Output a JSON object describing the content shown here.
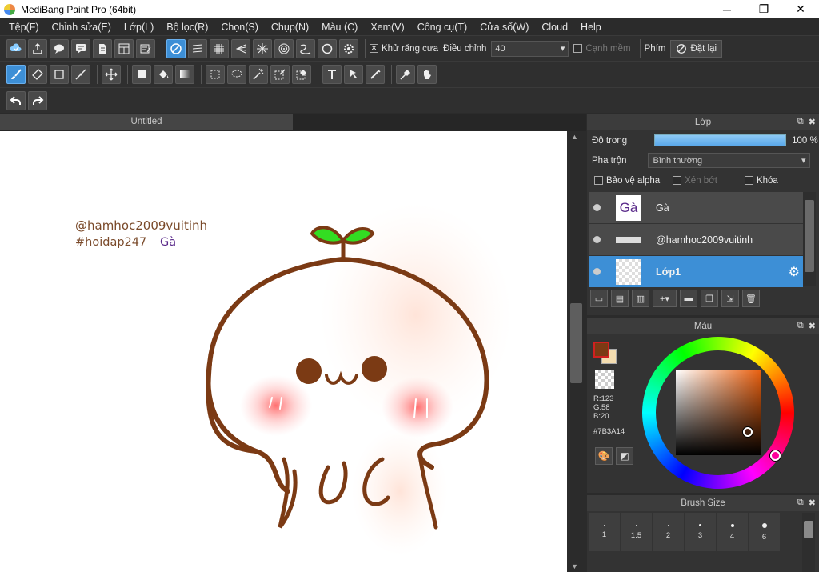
{
  "window": {
    "title": "MediBang Paint Pro (64bit)",
    "minimize": "─",
    "maximize": "❐",
    "close": "✕"
  },
  "menu": [
    "Tệp(F)",
    "Chỉnh sửa(E)",
    "Lớp(L)",
    "Bộ lọc(R)",
    "Chọn(S)",
    "Chụp(N)",
    "Màu (C)",
    "Xem(V)",
    "Công cụ(T)",
    "Cửa sổ(W)",
    "Cloud",
    "Help"
  ],
  "toolbar1": {
    "antialias_label": "Khử răng cưa",
    "antialias_checked": "✕",
    "adjust_label": "Điều chỉnh",
    "adjust_value": "40",
    "soft_edge_label": "Cạnh mềm",
    "key_label": "Phím",
    "reset_label": "Đặt lại"
  },
  "document": {
    "tab": "Untitled",
    "text_line1": "@hamhoc2009vuitinh",
    "text_line2": "#hoidap247",
    "text_line3": "Gà"
  },
  "layer_panel": {
    "title": "Lớp",
    "opacity_label": "Độ trong",
    "opacity_value": "100 %",
    "opacity": 1.0,
    "blend_label": "Pha trộn",
    "blend_value": "Bình thường",
    "protect_alpha": "Bảo vệ alpha",
    "clipping": "Xén bớt",
    "lock": "Khóa",
    "layers": [
      {
        "name": "Gà",
        "thumb_text": "Gà"
      },
      {
        "name": "@hamhoc2009vuitinh",
        "thumb_text": ""
      },
      {
        "name": "Lớp1",
        "thumb_text": ""
      }
    ]
  },
  "color_panel": {
    "title": "Màu",
    "r": "R:123",
    "g": "G:58",
    "b": "B:20",
    "hex": "#7B3A14",
    "fg_color": "#7B3A14",
    "bg_color": "#f4ddb0"
  },
  "brush_panel": {
    "title": "Brush Size",
    "sizes": [
      "1",
      "1.5",
      "2",
      "3",
      "4",
      "6"
    ]
  }
}
